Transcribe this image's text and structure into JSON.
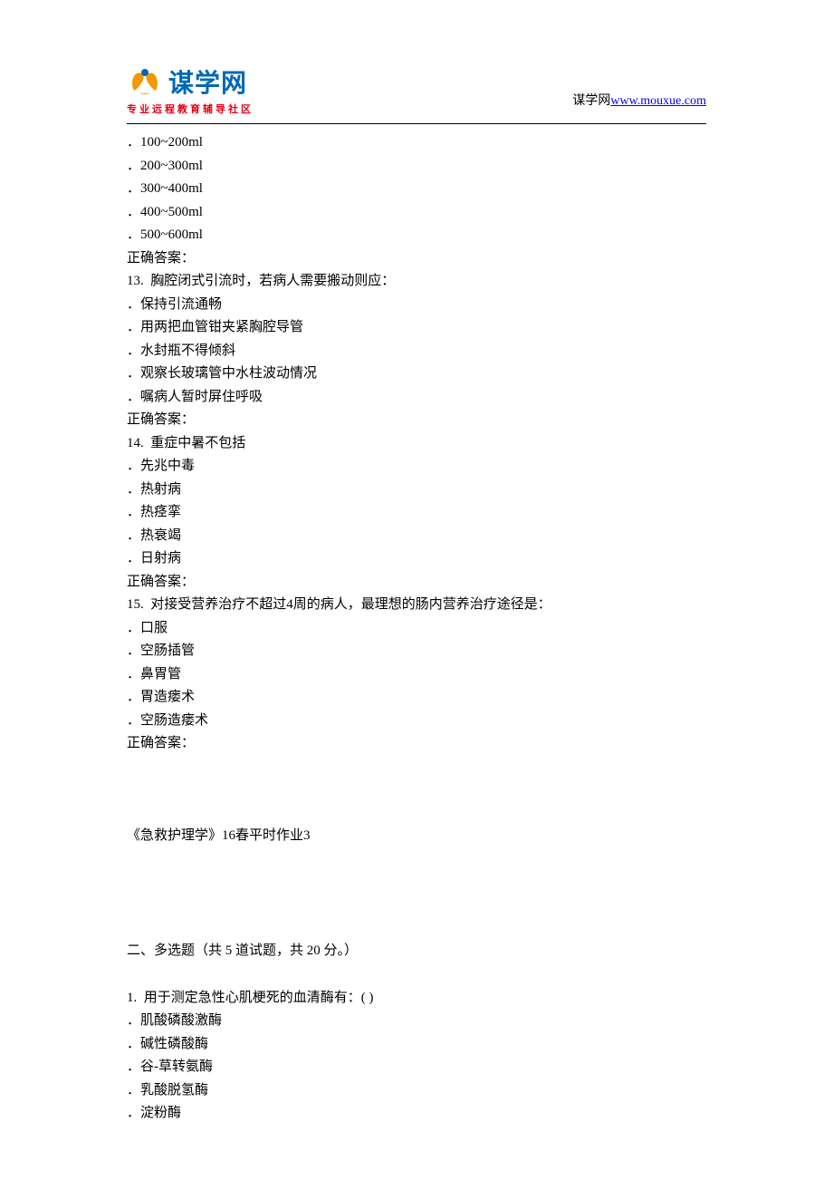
{
  "header": {
    "logo_main": "谋学网",
    "logo_sub": "www.mouxue.com",
    "logo_tagline": "专业远程教育辅导社区",
    "site_label": "谋学网",
    "site_url": "www.mouxue.com"
  },
  "q12_options": [
    "．100~200ml",
    "．200~300ml",
    "．300~400ml",
    "．400~500ml",
    "．500~600ml"
  ],
  "answer_label": "正确答案：",
  "q13": {
    "title": "13.  胸腔闭式引流时，若病人需要搬动则应：",
    "options": [
      "．保持引流通畅",
      "．用两把血管钳夹紧胸腔导管",
      "．水封瓶不得倾斜",
      "．观察长玻璃管中水柱波动情况",
      "．嘱病人暂时屏住呼吸"
    ]
  },
  "q14": {
    "title": "14.  重症中暑不包括",
    "options": [
      "．先兆中毒",
      "．热射病",
      "．热痉挛",
      "．热衰竭",
      "．日射病"
    ]
  },
  "q15": {
    "title": "15.  对接受营养治疗不超过4周的病人，最理想的肠内营养治疗途径是：",
    "options": [
      "．口服",
      "．空肠插管",
      "．鼻胃管",
      "．胃造瘘术",
      "．空肠造瘘术"
    ]
  },
  "assignment_title": "《急救护理学》16春平时作业3",
  "section2_title": "二、多选题（共 5 道试题，共 20 分。）",
  "mq1": {
    "title": "1.  用于测定急性心肌梗死的血清酶有：( )",
    "options": [
      "．肌酸磷酸激酶",
      "．碱性磷酸酶",
      "．谷-草转氨酶",
      "．乳酸脱氢酶",
      "．淀粉酶"
    ]
  }
}
